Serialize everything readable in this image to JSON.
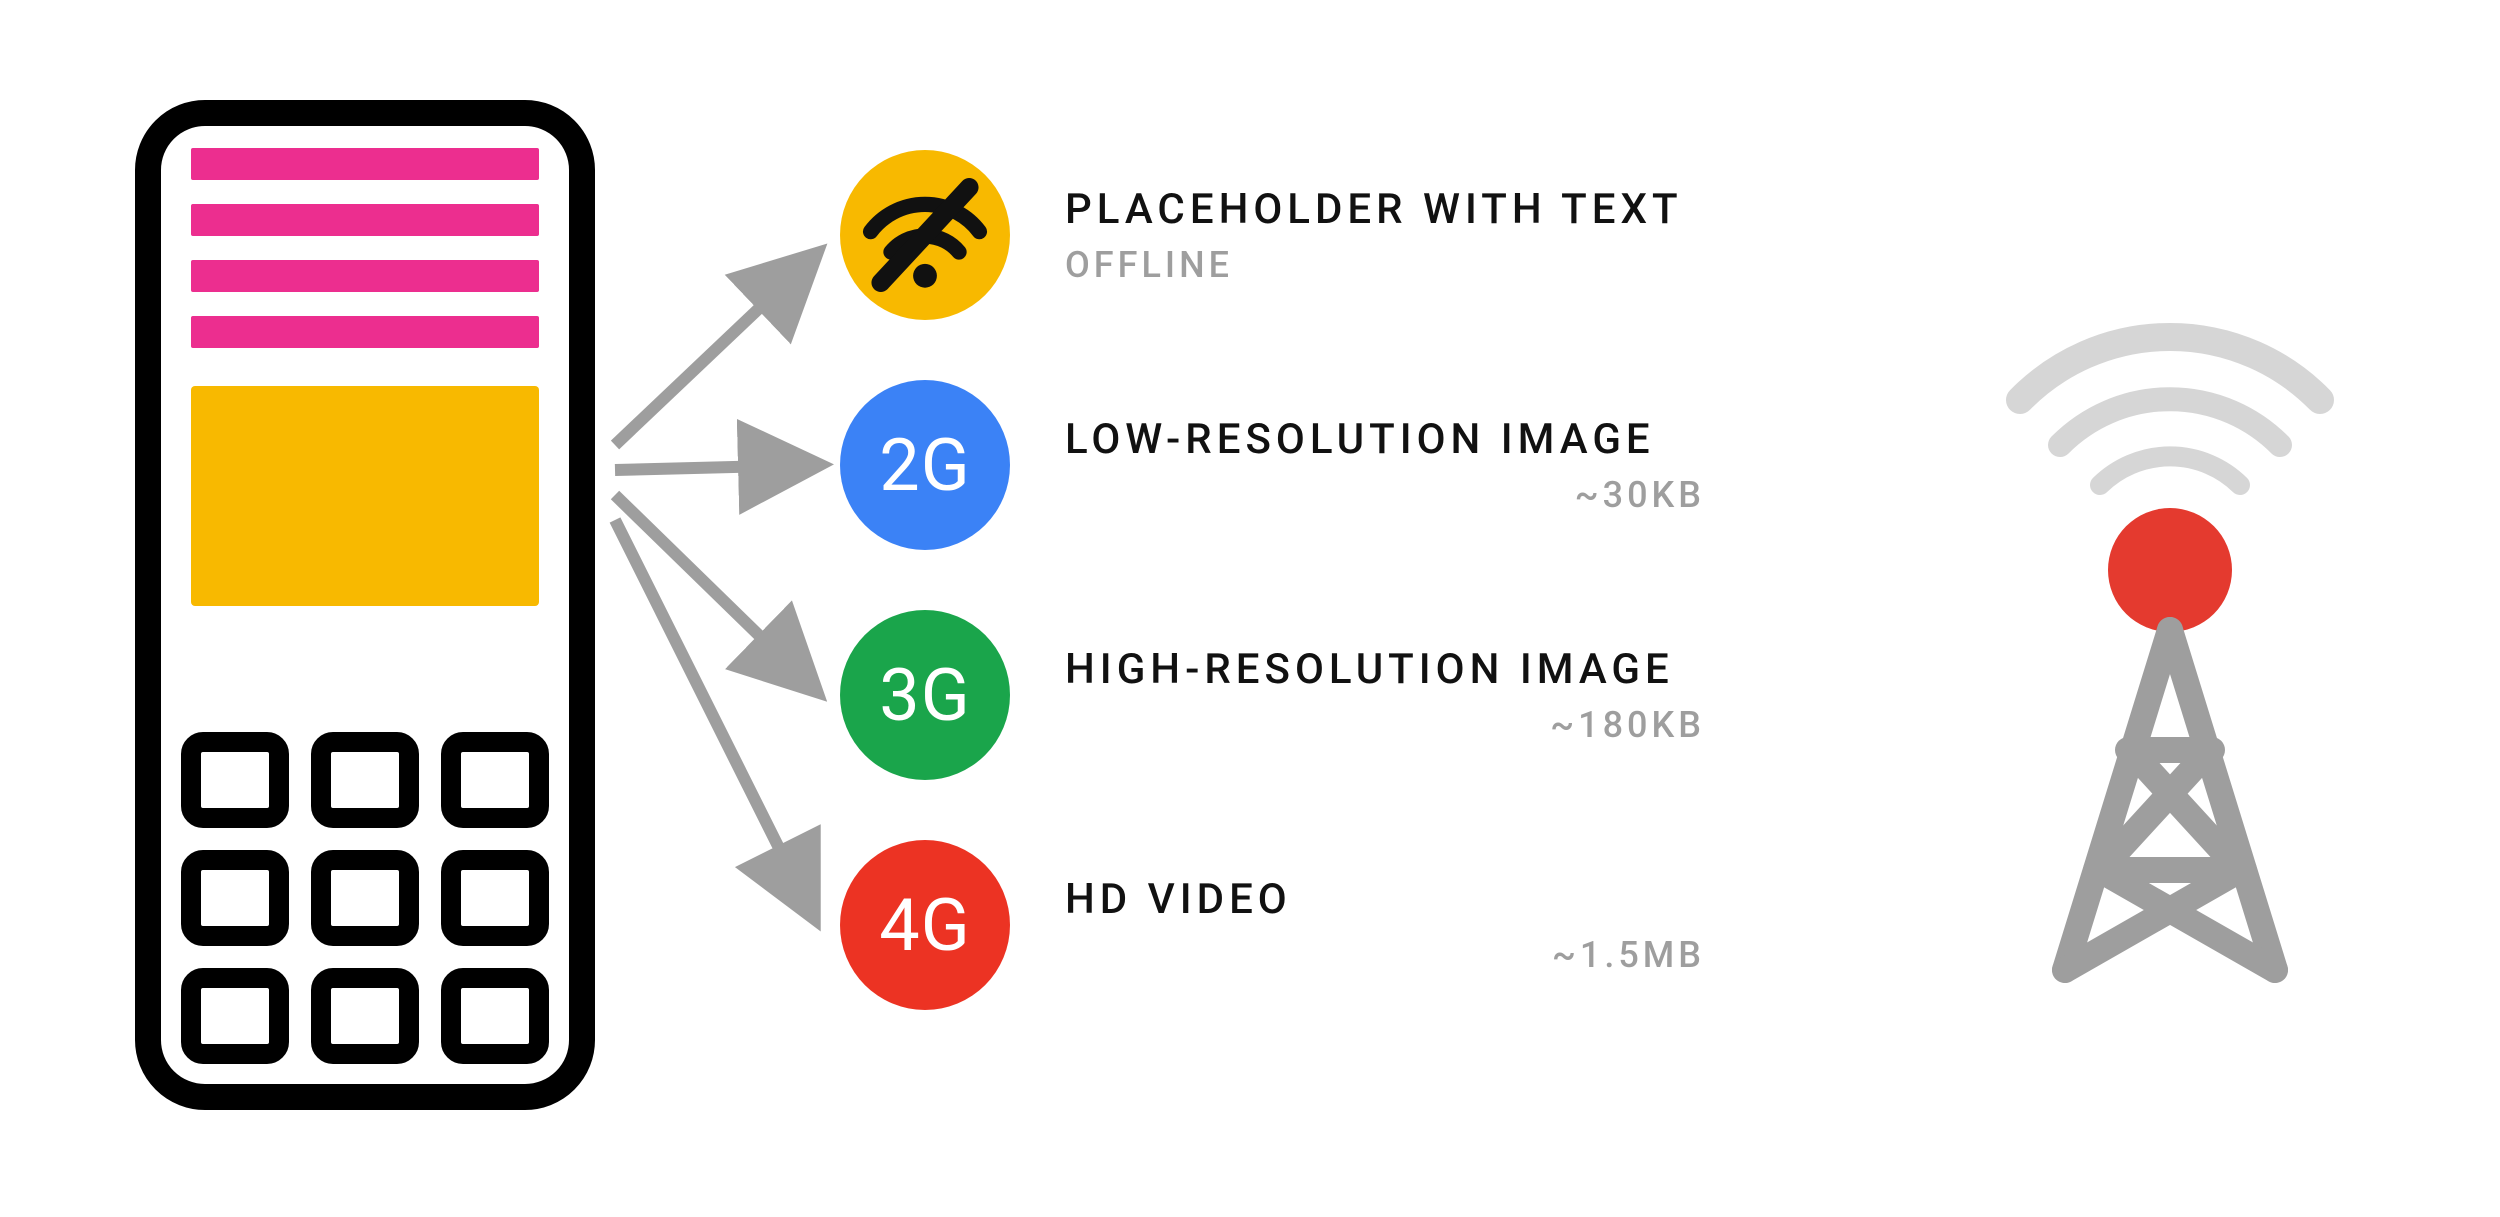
{
  "colors": {
    "pink": "#ec2e8f",
    "amber": "#f8b900",
    "blue": "#3b82f6",
    "green": "#1aa54b",
    "red": "#ec3323",
    "gray": "#9e9e9e",
    "lightgray": "#d6d6d6"
  },
  "options": [
    {
      "badge": "offline",
      "badge_color": "amber",
      "badge_text": "",
      "title": "PLACEHOLDER WITH TEXT",
      "sub": "OFFLINE",
      "sub_align": "left"
    },
    {
      "badge": "text",
      "badge_color": "blue",
      "badge_text": "2G",
      "title": "LOW-RESOLUTION IMAGE",
      "sub": "~30KB",
      "sub_align": "right"
    },
    {
      "badge": "text",
      "badge_color": "green",
      "badge_text": "3G",
      "title": "HIGH-RESOLUTION IMAGE",
      "sub": "~180KB",
      "sub_align": "right"
    },
    {
      "badge": "text",
      "badge_color": "red",
      "badge_text": "4G",
      "title": "HD VIDEO",
      "sub": "~1.5MB",
      "sub_align": "right"
    }
  ]
}
